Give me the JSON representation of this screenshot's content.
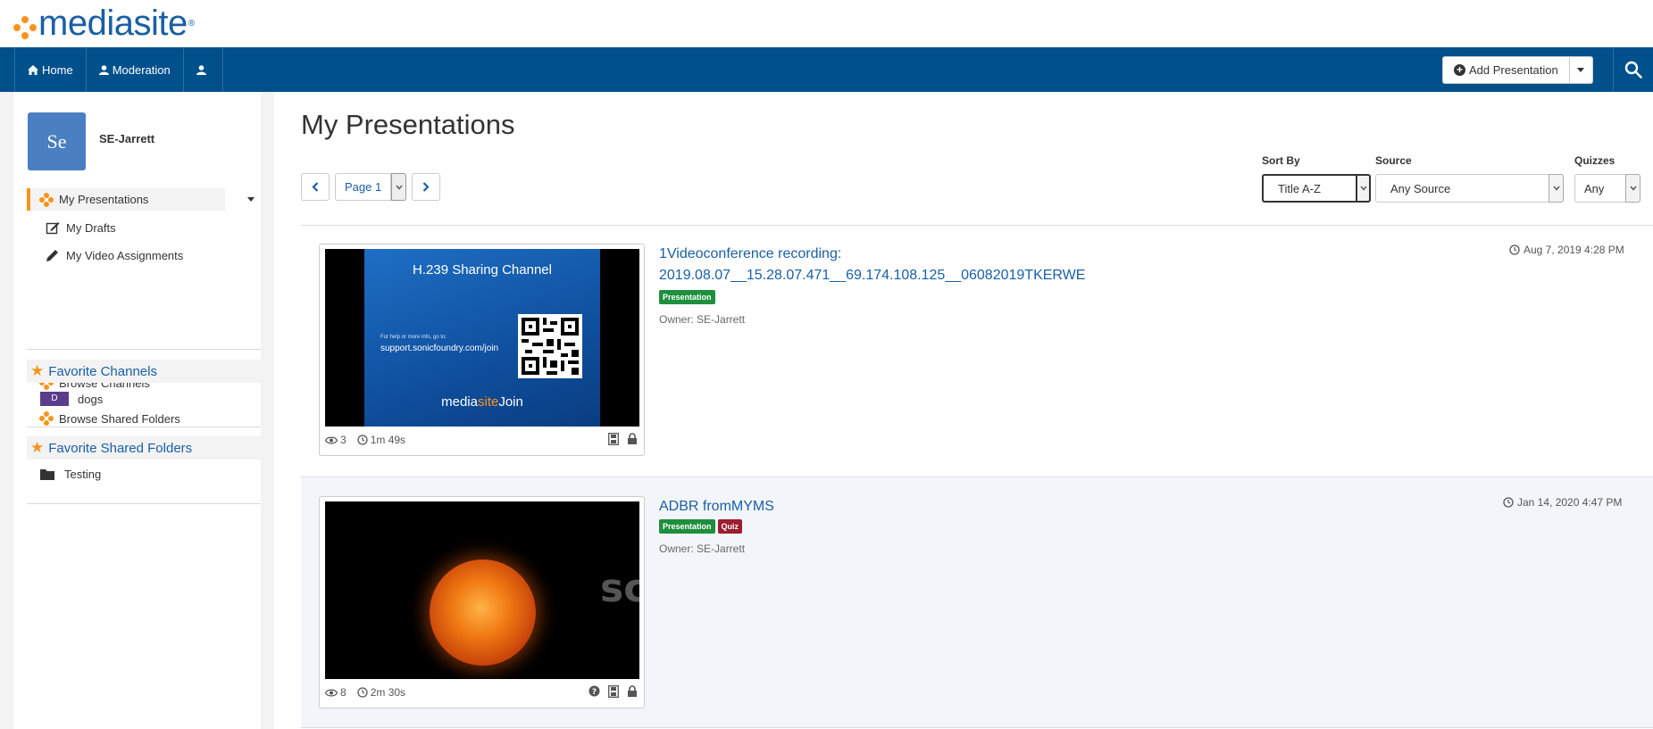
{
  "logo": {
    "text": "mediasite",
    "reg": "®"
  },
  "nav": {
    "home_label": "Home",
    "moderation_label": "Moderation",
    "add_presentation_label": "Add Presentation"
  },
  "sidebar": {
    "avatar_initials": "Se",
    "username": "SE-Jarrett",
    "items": [
      {
        "label": "My Presentations"
      },
      {
        "label": "My Drafts"
      },
      {
        "label": "My Video Assignments"
      },
      {
        "label": "Browse Channels"
      },
      {
        "label": "Browse Shared Folders"
      }
    ],
    "favorite_channels": {
      "heading": "Favorite Channels",
      "items": [
        {
          "badge": "D",
          "label": "dogs"
        }
      ]
    },
    "favorite_folders": {
      "heading": "Favorite Shared Folders",
      "items": [
        {
          "label": "Testing"
        }
      ]
    }
  },
  "main": {
    "title": "My Presentations",
    "pager": {
      "page_label": "Page 1"
    },
    "filters": {
      "sort_by": {
        "label": "Sort By",
        "value": "Title A-Z"
      },
      "source": {
        "label": "Source",
        "value": "Any Source"
      },
      "quizzes": {
        "label": "Quizzes",
        "value": "Any"
      }
    },
    "presentations": [
      {
        "title_line1": "1Videoconference recording:",
        "title_line2": "2019.08.07__15.28.07.471__69.174.108.125__06082019TKERWE",
        "tags": [
          "Presentation"
        ],
        "owner": "Owner: SE-Jarrett",
        "date": "Aug 7, 2019 4:28 PM",
        "views": "3",
        "duration": "1m 49s",
        "slide": {
          "title": "H.239 Sharing Channel",
          "help_text": "For help or more info, go to:",
          "url": "support.sonicfoundry.com/join",
          "brand_part1": "media",
          "brand_part2": "site",
          "brand_part3": "Join"
        }
      },
      {
        "title": "ADBR fromMYMS",
        "tags": [
          "Presentation",
          "Quiz"
        ],
        "owner": "Owner: SE-Jarrett",
        "date": "Jan 14, 2020 4:47 PM",
        "views": "8",
        "duration": "2m 30s",
        "slide_text": "sc"
      }
    ]
  },
  "colors": {
    "navbar": "#00508c",
    "accent": "#f7941d",
    "link": "#1a5fa6",
    "tag_presentation": "#1e8f3d",
    "tag_quiz": "#9b1d2e"
  }
}
